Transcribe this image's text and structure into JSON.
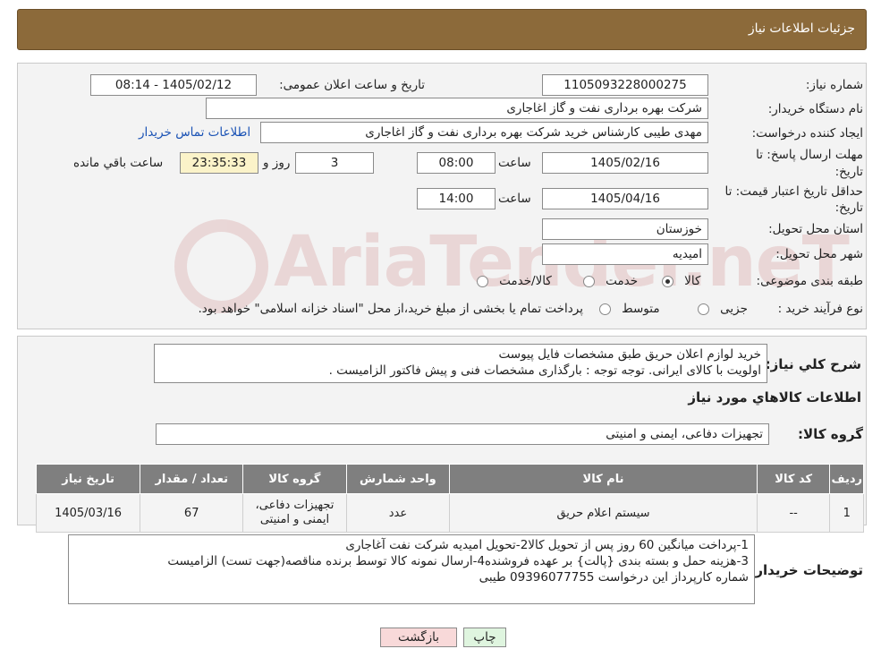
{
  "header": {
    "title": "جزئیات اطلاعات نیاز"
  },
  "form": {
    "need_number_label": "شماره نیاز:",
    "need_number": "1105093228000275",
    "announce_label": "تاریخ و ساعت اعلان عمومی:",
    "announce_value": "1405/02/12 - 08:14",
    "buyer_org_label": "نام دستگاه خریدار:",
    "buyer_org": "شرکت بهره برداری نفت و گاز اغاجاری",
    "creator_label": "ایجاد کننده درخواست:",
    "creator": "مهدی طیبی کارشناس خرید شرکت بهره برداری نفت و گاز اغاجاری",
    "contact_link": "اطلاعات تماس خریدار",
    "deadline_label_1": "مهلت ارسال پاسخ: تا",
    "deadline_label_2": "تاریخ:",
    "deadline_date": "1405/02/16",
    "time_label": "ساعت",
    "deadline_time": "08:00",
    "days_value": "3",
    "days_label": "روز و",
    "remaining_value": "23:35:33",
    "remaining_label": "ساعت باقي مانده",
    "validity_label_1": "حداقل تاریخ اعتبار قیمت: تا",
    "validity_label_2": "تاریخ:",
    "validity_date": "1405/04/16",
    "validity_time": "14:00",
    "province_label": "استان محل تحویل:",
    "province": "خوزستان",
    "city_label": "شهر محل تحویل:",
    "city": "امیدیه",
    "category_label": "طبقه بندی موضوعی:",
    "category_options": [
      "کالا",
      "خدمت",
      "کالا/خدمت"
    ],
    "category_selected": "کالا",
    "process_label": "نوع فرآیند خرید :",
    "process_options": [
      "جزیی",
      "متوسط"
    ],
    "process_note": "پرداخت تمام یا بخشی از مبلغ خرید،از محل \"اسناد خزانه اسلامی\" خواهد بود."
  },
  "summary": {
    "label": "شرح کلي نياز:",
    "line1": "خرید لوازم اعلان حریق طبق مشخصات فایل پیوست",
    "line2": "اولویت با کالای ایرانی. توجه توجه : بارگذاری مشخصات فنی و پیش فاکتور الزامیست ."
  },
  "items_section": {
    "title": "اطلاعات کالاهاي مورد نياز",
    "group_label": "گروه کالا:",
    "group_value": "تجهیزات دفاعی، ایمنی و امنیتی",
    "columns": [
      "رديف",
      "کد کالا",
      "نام کالا",
      "واحد شمارش",
      "گروه کالا",
      "تعداد / مقدار",
      "تاریخ نیاز"
    ],
    "rows": [
      {
        "index": "1",
        "code": "--",
        "name": "سیستم اعلام حریق",
        "unit": "عدد",
        "group_l1": "تجهیزات دفاعی،",
        "group_l2": "ایمنی و امنیتی",
        "qty": "67",
        "date": "1405/03/16"
      }
    ]
  },
  "buyer_notes": {
    "label": "توضیحات خریدار:",
    "line1": "1-پرداخت میانگین 60 روز پس از تحویل کالا2-تحویل امیدیه شرکت نفت آغاجاری",
    "line2": "3-هزینه حمل  و بسته بندی {پالت} بر عهده فروشنده4-ارسال نمونه کالا توسط برنده مناقصه(جهت تست) الزامیست",
    "line3": "شماره کارپرداز این درخواست 09396077755 طیبی"
  },
  "buttons": {
    "print": "چاپ",
    "back": "بازگشت"
  },
  "watermark": "AriaTender.neT",
  "colors": {
    "header": "#8c6a3a",
    "table_header": "#7f7f7f",
    "back_button": "#f8d9d9",
    "print_button": "#dff5df"
  }
}
